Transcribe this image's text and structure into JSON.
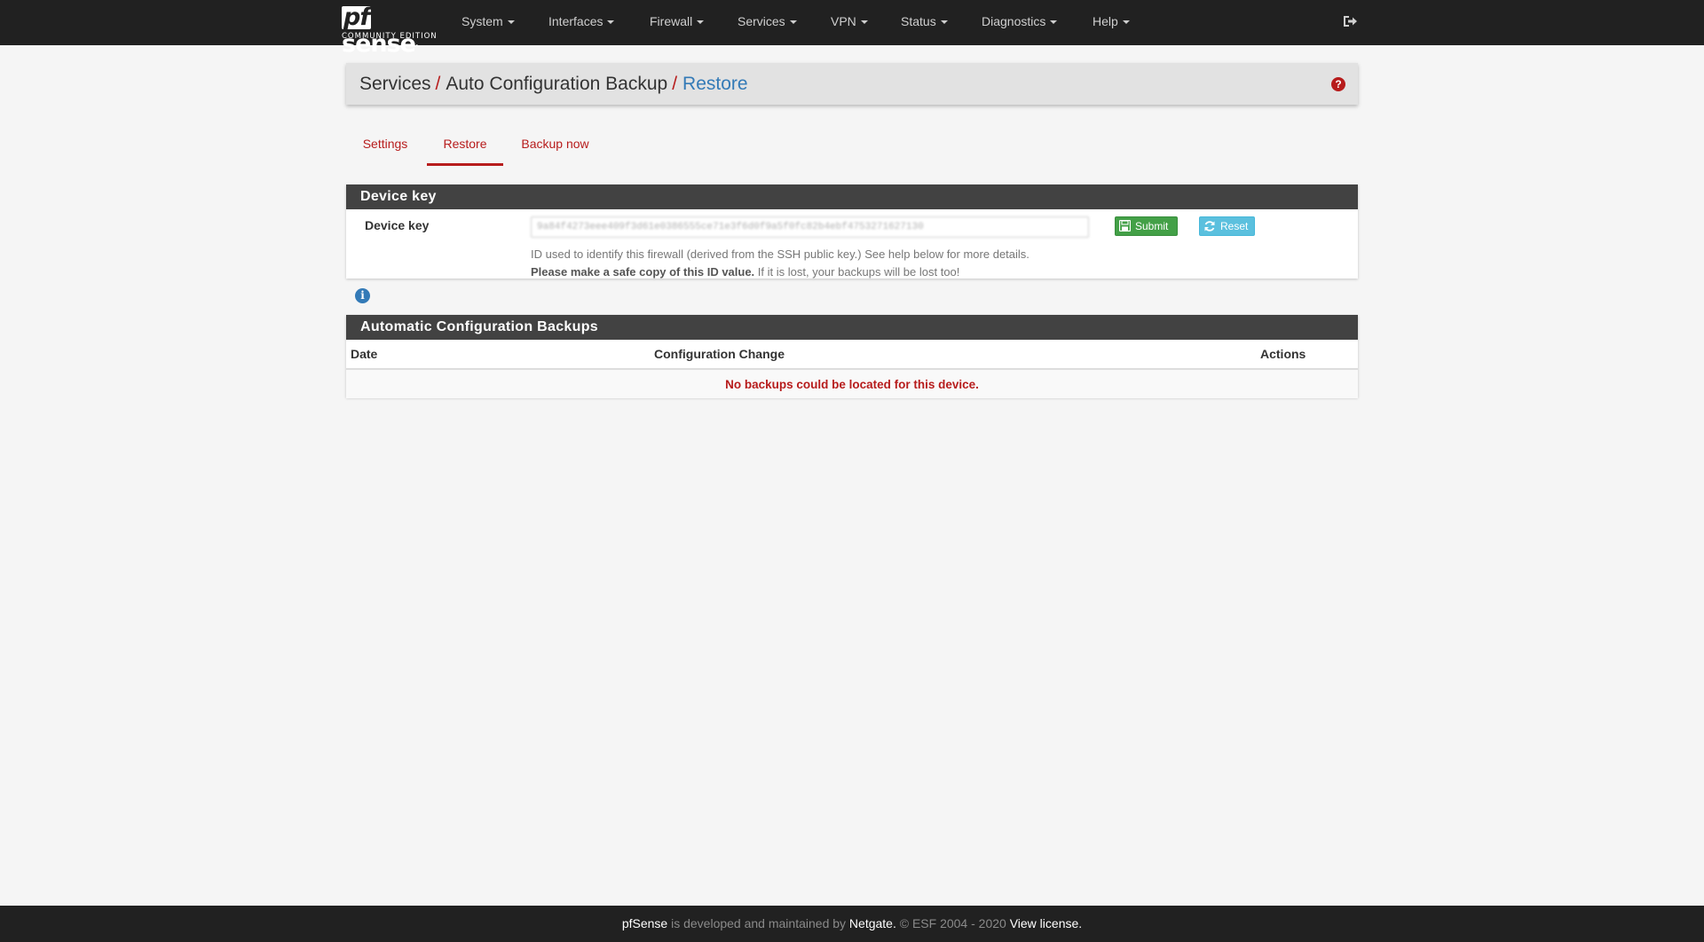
{
  "brand": {
    "logo_pf": "pf",
    "logo_sense": "sense",
    "logo_mark": ".",
    "edition": "COMMUNITY EDITION"
  },
  "nav": {
    "system": "System",
    "interfaces": "Interfaces",
    "firewall": "Firewall",
    "services": "Services",
    "vpn": "VPN",
    "status": "Status",
    "diagnostics": "Diagnostics",
    "help": "Help"
  },
  "breadcrumb": {
    "level1": "Services",
    "level2": "Auto Configuration Backup",
    "current": "Restore",
    "separator": "/"
  },
  "tabs": {
    "settings": "Settings",
    "restore": "Restore",
    "backup_now": "Backup now"
  },
  "device_key_panel": {
    "title": "Device key",
    "label": "Device key",
    "value": "9a84f4273eee409f3d61e0386555ce71e3f6d0f9a5f0fc82b4ebf4753271627130",
    "submit_label": "Submit",
    "reset_label": "Reset",
    "help_line1": "ID used to identify this firewall (derived from the SSH public key.) See help below for more details.",
    "help_line2_bold": "Please make a safe copy of this ID value.",
    "help_line2_rest": " If it is lost, your backups will be lost too!"
  },
  "backups_panel": {
    "title": "Automatic Configuration Backups",
    "columns": [
      "Date",
      "Configuration Change",
      "Actions"
    ],
    "empty_message": "No backups could be located for this device."
  },
  "footer": {
    "product": "pfSense",
    "text1": " is developed and maintained by ",
    "company": "Netgate.",
    "text2": " © ESF 2004 - 2020 ",
    "license": "View license."
  },
  "colors": {
    "navbar": "#212121",
    "accent_red": "#b71c1c",
    "link_blue": "#337ab7",
    "panel_heading": "#424242",
    "submit_green": "#43a047",
    "reset_cyan": "#5bc0de"
  },
  "icons": {
    "logout": "sign-out-icon",
    "help": "question-circle-icon",
    "info": "info-circle-icon",
    "submit": "floppy-disk-icon",
    "reset": "refresh-icon"
  }
}
